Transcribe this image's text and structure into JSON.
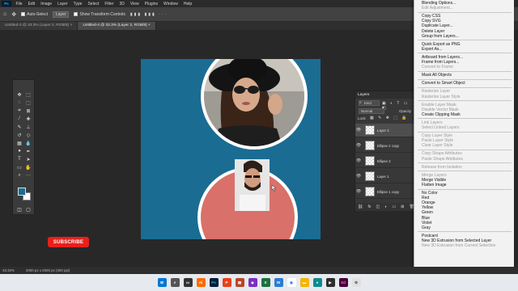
{
  "menubar": {
    "logo": "Ps",
    "items": [
      "File",
      "Edit",
      "Image",
      "Layer",
      "Type",
      "Select",
      "Filter",
      "3D",
      "View",
      "Plugins",
      "Window",
      "Help"
    ]
  },
  "options": {
    "auto_select": "Auto-Select",
    "target": "Layer",
    "transform": "Show Transform Controls"
  },
  "tabs": [
    {
      "label": "Untitled-3 @ 33.3% (Layer 2, RGB/8) ×",
      "active": false
    },
    {
      "label": "Untitled-4 @ 33.3% (Layer 2, RGB/8) ×",
      "active": true
    }
  ],
  "layers_panel": {
    "title": "Layers",
    "filter": "Kind",
    "blend": "Normal",
    "opacity": "Opacity",
    "lock": "Lock:",
    "rows": [
      {
        "name": "Layer 2",
        "selected": true
      },
      {
        "name": "Ellipse 2 copy",
        "selected": false
      },
      {
        "name": "Ellipse 2",
        "selected": false
      },
      {
        "name": "Layer 1",
        "selected": false
      },
      {
        "name": "Ellipse 1 copy",
        "selected": false
      }
    ]
  },
  "context_menu": [
    {
      "label": "Blending Options...",
      "disabled": false
    },
    {
      "label": "Edit Adjustment...",
      "disabled": true
    },
    {
      "sep": true
    },
    {
      "label": "Copy CSS",
      "disabled": false
    },
    {
      "label": "Copy SVG",
      "disabled": false
    },
    {
      "label": "Duplicate Layer...",
      "disabled": false
    },
    {
      "label": "Delete Layer",
      "disabled": false
    },
    {
      "label": "Group from Layers...",
      "disabled": false
    },
    {
      "sep": true
    },
    {
      "label": "Quick Export as PNG",
      "disabled": false
    },
    {
      "label": "Export As...",
      "disabled": false
    },
    {
      "sep": true
    },
    {
      "label": "Artboard from Layers...",
      "disabled": false
    },
    {
      "label": "Frame from Layers...",
      "disabled": false
    },
    {
      "label": "Convert to Frame",
      "disabled": true
    },
    {
      "sep": true
    },
    {
      "label": "Mask All Objects",
      "disabled": false
    },
    {
      "sep": true
    },
    {
      "label": "Convert to Smart Object",
      "disabled": false
    },
    {
      "sep": true
    },
    {
      "label": "Rasterize Layer",
      "disabled": true
    },
    {
      "label": "Rasterize Layer Style",
      "disabled": true
    },
    {
      "sep": true
    },
    {
      "label": "Enable Layer Mask",
      "disabled": true
    },
    {
      "label": "Disable Vector Mask",
      "disabled": true
    },
    {
      "label": "Create Clipping Mask",
      "disabled": false
    },
    {
      "sep": true
    },
    {
      "label": "Link Layers",
      "disabled": true
    },
    {
      "label": "Select Linked Layers",
      "disabled": true
    },
    {
      "sep": true
    },
    {
      "label": "Copy Layer Style",
      "disabled": true
    },
    {
      "label": "Paste Layer Style",
      "disabled": true
    },
    {
      "label": "Clear Layer Style",
      "disabled": true
    },
    {
      "sep": true
    },
    {
      "label": "Copy Shape Attributes",
      "disabled": true
    },
    {
      "label": "Paste Shape Attributes",
      "disabled": true
    },
    {
      "sep": true
    },
    {
      "label": "Release from Isolation",
      "disabled": true
    },
    {
      "sep": true
    },
    {
      "label": "Merge Layers",
      "disabled": true
    },
    {
      "label": "Merge Visible",
      "disabled": false
    },
    {
      "label": "Flatten Image",
      "disabled": false
    },
    {
      "sep": true
    },
    {
      "label": "No Color",
      "disabled": false
    },
    {
      "label": "Red",
      "disabled": false
    },
    {
      "label": "Orange",
      "disabled": false
    },
    {
      "label": "Yellow",
      "disabled": false
    },
    {
      "label": "Green",
      "disabled": false
    },
    {
      "label": "Blue",
      "disabled": false
    },
    {
      "label": "Violet",
      "disabled": false
    },
    {
      "label": "Gray",
      "disabled": false
    },
    {
      "sep": true
    },
    {
      "label": "Postcard",
      "disabled": false
    },
    {
      "label": "New 3D Extrusion from Selected Layer",
      "disabled": false
    },
    {
      "label": "New 3D Extrusion from Current Selection",
      "disabled": true
    }
  ],
  "status": {
    "zoom": "33.33%",
    "doc": "2000 px x 2000 px (300 ppi)"
  },
  "subscribe": "SUBSCRIBE",
  "colors": {
    "canvas_bg": "#1a6c93",
    "coral": "#d9706a",
    "accent": "#31a8ff"
  }
}
